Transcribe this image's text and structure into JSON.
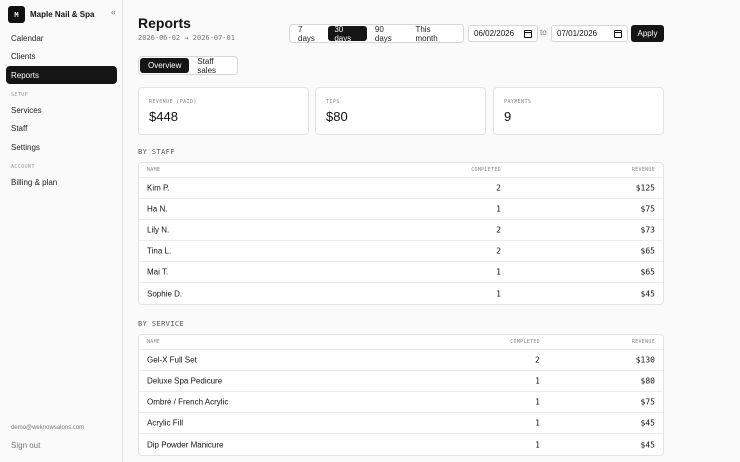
{
  "sidebar": {
    "logo_letter": "M",
    "brand": "Maple Nail & Spa",
    "collapse_icon": "«",
    "items": [
      {
        "label": "Calendar"
      },
      {
        "label": "Clients"
      },
      {
        "label": "Reports"
      }
    ],
    "setup_label": "SETUP",
    "setup_items": [
      {
        "label": "Services"
      },
      {
        "label": "Staff"
      },
      {
        "label": "Settings"
      }
    ],
    "account_label": "ACCOUNT",
    "account_items": [
      {
        "label": "Billing & plan"
      }
    ],
    "email": "demo@weknowsalons.com",
    "signout": "Sign out"
  },
  "header": {
    "title": "Reports",
    "daterange": "2026-06-02 → 2026-07-01",
    "ranges": [
      "7 days",
      "30 days",
      "90 days",
      "This month"
    ],
    "active_range": "30 days",
    "from_date": "06/02/2026",
    "to_label": "to",
    "to_date": "07/01/2026",
    "apply": "Apply"
  },
  "tabs": [
    "Overview",
    "Staff sales"
  ],
  "stats": [
    {
      "label": "REVENUE (PAID)",
      "value": "$448"
    },
    {
      "label": "TIPS",
      "value": "$80"
    },
    {
      "label": "PAYMENTS",
      "value": "9"
    }
  ],
  "by_staff": {
    "heading": "BY STAFF",
    "columns": [
      "NAME",
      "COMPLETED",
      "REVENUE"
    ],
    "rows": [
      {
        "name": "Kim P.",
        "completed": "2",
        "revenue": "$125"
      },
      {
        "name": "Ha N.",
        "completed": "1",
        "revenue": "$75"
      },
      {
        "name": "Lily N.",
        "completed": "2",
        "revenue": "$73"
      },
      {
        "name": "Tina L.",
        "completed": "2",
        "revenue": "$65"
      },
      {
        "name": "Mai T.",
        "completed": "1",
        "revenue": "$65"
      },
      {
        "name": "Sophie D.",
        "completed": "1",
        "revenue": "$45"
      }
    ]
  },
  "by_service": {
    "heading": "BY SERVICE",
    "columns": [
      "NAME",
      "COMPLETED",
      "REVENUE"
    ],
    "rows": [
      {
        "name": "Gel-X Full Set",
        "completed": "2",
        "revenue": "$130"
      },
      {
        "name": "Deluxe Spa Pedicure",
        "completed": "1",
        "revenue": "$80"
      },
      {
        "name": "Ombré / French Acrylic",
        "completed": "1",
        "revenue": "$75"
      },
      {
        "name": "Acrylic Fill",
        "completed": "1",
        "revenue": "$45"
      },
      {
        "name": "Dip Powder Manicure",
        "completed": "1",
        "revenue": "$45"
      }
    ]
  }
}
